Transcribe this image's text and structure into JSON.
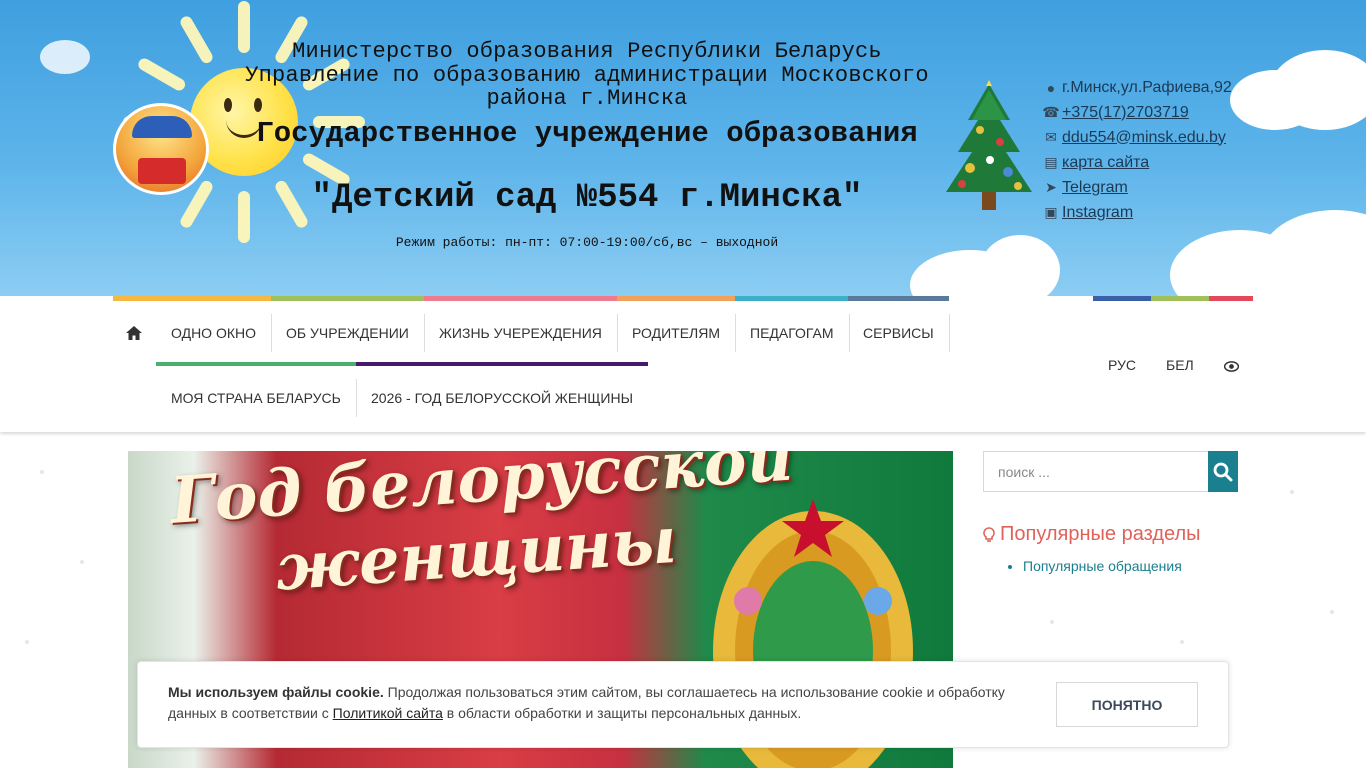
{
  "header": {
    "ministry_line1": "Министерство образования Республики Беларусь",
    "ministry_line2": "Управление по образованию администрации Московского района г.Минска",
    "institution": "Государственное учреждение образования",
    "kindergarten": "\"Детский сад №554 г.Минска\"",
    "hours": "Режим работы: пн-пт: 07:00-19:00/сб,вс – выходной",
    "logo_icon": "kindergarten-logo",
    "tree_icon": "christmas-tree-icon"
  },
  "contacts": {
    "address": "г.Минск,ул.Рафиева,92",
    "phone": "+375(17)2703719",
    "email": "ddu554@minsk.edu.by",
    "sitemap": "карта сайта",
    "telegram": "Telegram",
    "instagram": "Instagram"
  },
  "stripe_colors": [
    "#f5b942",
    "#9fc05a",
    "#ef7b8f",
    "#f0a25a",
    "#3bb0c6",
    "#5a7a9a",
    "#ffffff",
    "#3b5fa8",
    "#9fc05a",
    "#e04a5c"
  ],
  "nav": {
    "home_icon": "home-icon",
    "items_row1": [
      "ОДНО ОКНО",
      "ОБ УЧРЕЖДЕНИИ",
      "ЖИЗНЬ УЧЕРЕЖДЕНИЯ",
      "РОДИТЕЛЯМ",
      "ПЕДАГОГАМ",
      "СЕРВИСЫ"
    ],
    "items_row2": [
      "МОЯ СТРАНА БЕЛАРУСЬ",
      "2026 - ГОД БЕЛОРУССКОЙ ЖЕНЩИНЫ"
    ],
    "lang_ru": "РУС",
    "lang_by": "БЕЛ",
    "accessibility_icon": "eye-icon"
  },
  "banner": {
    "title_line1": "Год белорусской",
    "title_line2": "женщины"
  },
  "search": {
    "placeholder": "поиск ...",
    "icon": "search-icon"
  },
  "popular": {
    "title": "Популярные разделы",
    "items": [
      "Популярные обращения"
    ]
  },
  "cookie": {
    "bold": "Мы используем файлы cookie.",
    "text1": " Продолжая пользоваться этим сайтом, вы соглашаетесь на использование cookie и обработку данных в соответствии с ",
    "link": "Политикой сайта",
    "text2": " в области обработки и защиты персональных данных.",
    "button": "ПОНЯТНО"
  }
}
